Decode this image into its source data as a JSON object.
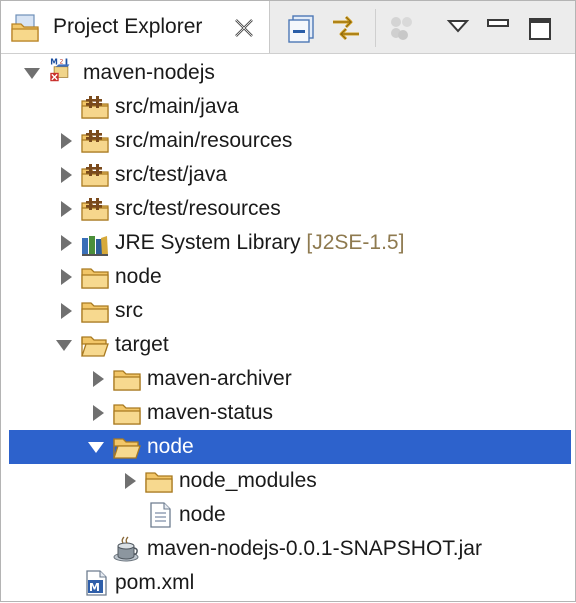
{
  "view": {
    "title": "Project Explorer",
    "close_icon": "close-x-icon",
    "toolbar": [
      {
        "name": "collapse-all-button",
        "icon": "collapse-all-icon"
      },
      {
        "name": "link-with-editor-button",
        "icon": "link-editor-icon"
      },
      {
        "name": "filters-button",
        "icon": "filters-icon"
      },
      {
        "name": "view-menu-button",
        "icon": "triangle-down-icon"
      },
      {
        "name": "minimize-button",
        "icon": "minimize-icon"
      },
      {
        "name": "maximize-button",
        "icon": "maximize-icon"
      }
    ]
  },
  "tree": [
    {
      "label": "maven-nodejs",
      "level": 0,
      "state": "expanded",
      "icon": "maven-project-icon"
    },
    {
      "label": "src/main/java",
      "level": 1,
      "state": "leaf",
      "icon": "source-folder-icon"
    },
    {
      "label": "src/main/resources",
      "level": 1,
      "state": "collapsed",
      "icon": "source-folder-icon"
    },
    {
      "label": "src/test/java",
      "level": 1,
      "state": "collapsed",
      "icon": "source-folder-icon"
    },
    {
      "label": "src/test/resources",
      "level": 1,
      "state": "collapsed",
      "icon": "source-folder-icon"
    },
    {
      "label": "JRE System Library",
      "decoration": "[J2SE-1.5]",
      "level": 1,
      "state": "collapsed",
      "icon": "library-icon"
    },
    {
      "label": "node",
      "level": 1,
      "state": "collapsed",
      "icon": "folder-icon"
    },
    {
      "label": "src",
      "level": 1,
      "state": "collapsed",
      "icon": "folder-icon"
    },
    {
      "label": "target",
      "level": 1,
      "state": "expanded",
      "icon": "folder-open-icon"
    },
    {
      "label": "maven-archiver",
      "level": 2,
      "state": "collapsed",
      "icon": "folder-icon"
    },
    {
      "label": "maven-status",
      "level": 2,
      "state": "collapsed",
      "icon": "folder-icon"
    },
    {
      "label": "node",
      "level": 2,
      "state": "expanded",
      "icon": "folder-open-icon",
      "selected": true
    },
    {
      "label": "node_modules",
      "level": 3,
      "state": "collapsed",
      "icon": "folder-icon"
    },
    {
      "label": "node",
      "level": 3,
      "state": "leaf",
      "icon": "file-icon"
    },
    {
      "label": "maven-nodejs-0.0.1-SNAPSHOT.jar",
      "level": 2,
      "state": "leaf",
      "icon": "jar-icon"
    },
    {
      "label": "pom.xml",
      "level": 1,
      "state": "leaf",
      "icon": "maven-pom-icon"
    }
  ],
  "colors": {
    "selection": "#2d62cc",
    "decoration": "#8e7a4f",
    "folder": "#e9a53a"
  }
}
